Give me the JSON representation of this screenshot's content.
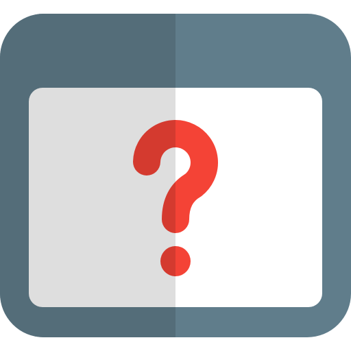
{
  "icon": {
    "name": "browser-window-question-icon",
    "colors": {
      "frame": "#607D8B",
      "frame_shade": "#546D79",
      "content": "#FFFFFF",
      "content_shade": "#DEDEDE",
      "symbol": "#F44336",
      "symbol_shade": "#D43A2F"
    }
  }
}
